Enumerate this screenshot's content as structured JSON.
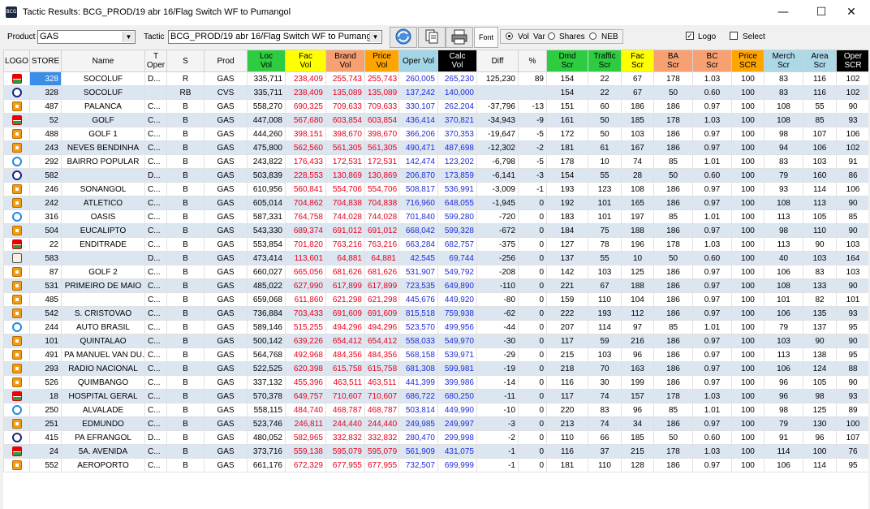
{
  "window": {
    "app_icon_text": "BCG",
    "title": "Tactic Results: BCG_PROD/19 abr 16/Flag Switch WF to Pumangol",
    "minimize": "—",
    "maximize": "☐",
    "close": "✕"
  },
  "toolbar": {
    "product_label": "Product",
    "product_value": "GAS",
    "tactic_label": "Tactic",
    "tactic_value": "BCG_PROD/19 abr 16/Flag Switch WF to Pumang",
    "font_label": "Font",
    "radio_vol": "Vol",
    "var_label": "Var",
    "radio_shares": "Shares",
    "radio_neb": "NEB",
    "logo_label": "Logo",
    "select_label": "Select",
    "logo_checked": true,
    "select_checked": false
  },
  "colors": {
    "green": "#2ecc40",
    "yellow": "#ffff00",
    "red_header": "#ff3333",
    "brand_header": "#f7a072",
    "price_header": "#ffa500",
    "oper_header": "#a3d5e6",
    "calc_header": "#000000",
    "blue_header": "#add8e6",
    "red_text": "#e8001c",
    "blue_text": "#1f2bd8"
  },
  "columns": [
    {
      "key": "logo",
      "label": "LOGO",
      "bg": "#f4f4f4",
      "fg": "#000"
    },
    {
      "key": "store",
      "label": "STORE",
      "bg": "#f4f4f4",
      "fg": "#000"
    },
    {
      "key": "name",
      "label": "Name",
      "bg": "#f4f4f4",
      "fg": "#000"
    },
    {
      "key": "toper",
      "label": "T\nOper",
      "bg": "#f4f4f4",
      "fg": "#000"
    },
    {
      "key": "s",
      "label": "S",
      "bg": "#f4f4f4",
      "fg": "#000"
    },
    {
      "key": "prod",
      "label": "Prod",
      "bg": "#f4f4f4",
      "fg": "#000"
    },
    {
      "key": "locvol",
      "label": "Loc\nVol",
      "bg": "#2ecc40",
      "fg": "#000"
    },
    {
      "key": "facvol",
      "label": "Fac\nVol",
      "bg": "#ffff00",
      "fg": "#000"
    },
    {
      "key": "brandvol",
      "label": "Brand\nVol",
      "bg": "#f7a072",
      "fg": "#000"
    },
    {
      "key": "pricevol",
      "label": "Price\nVol",
      "bg": "#ffa500",
      "fg": "#000"
    },
    {
      "key": "opervol",
      "label": "Oper Vol",
      "bg": "#a3d5e6",
      "fg": "#000"
    },
    {
      "key": "calcvol",
      "label": "Calc\nVol",
      "bg": "#000000",
      "fg": "#fff"
    },
    {
      "key": "diff",
      "label": "Diff",
      "bg": "#f4f4f4",
      "fg": "#000"
    },
    {
      "key": "pct",
      "label": "%",
      "bg": "#f4f4f4",
      "fg": "#000"
    },
    {
      "key": "dmdscr",
      "label": "Dmd\nScr",
      "bg": "#2ecc40",
      "fg": "#000"
    },
    {
      "key": "trafficscr",
      "label": "Traffic\nScr",
      "bg": "#2ecc40",
      "fg": "#000"
    },
    {
      "key": "facscr",
      "label": "Fac\nScr",
      "bg": "#ffff00",
      "fg": "#000"
    },
    {
      "key": "bascr",
      "label": "BA\nScr",
      "bg": "#f7a072",
      "fg": "#000"
    },
    {
      "key": "bcscr",
      "label": "BC\nScr",
      "bg": "#f7a072",
      "fg": "#000"
    },
    {
      "key": "pricescr",
      "label": "Price\nSCR",
      "bg": "#ffa500",
      "fg": "#000"
    },
    {
      "key": "merchscr",
      "label": "Merch\nScr",
      "bg": "#add8e6",
      "fg": "#000"
    },
    {
      "key": "areascr",
      "label": "Area\nScr",
      "bg": "#add8e6",
      "fg": "#000"
    },
    {
      "key": "operscr",
      "label": "Oper\nSCR",
      "bg": "#000000",
      "fg": "#fff"
    }
  ],
  "rows": [
    {
      "logo": "total-icon",
      "store": "328",
      "name": "SOCOLUF",
      "toper": "D...",
      "s": "R",
      "prod": "GAS",
      "locvol": "335,711",
      "facvol": "238,409",
      "brandvol": "255,743",
      "pricevol": "255,743",
      "opervol": "260,005",
      "calcvol": "265,230",
      "diff": "125,230",
      "pct": "89",
      "dmdscr": "154",
      "trafficscr": "22",
      "facscr": "67",
      "bascr": "178",
      "bcscr": "1.03",
      "pricescr": "100",
      "merchscr": "83",
      "areascr": "116",
      "operscr": "102"
    },
    {
      "logo": "sopor-icon",
      "store": "328",
      "name": "SOCOLUF",
      "toper": "",
      "s": "RB",
      "prod": "CVS",
      "locvol": "335,711",
      "facvol": "238,409",
      "brandvol": "135,089",
      "pricevol": "135,089",
      "opervol": "137,242",
      "calcvol": "140,000",
      "diff": "",
      "pct": "",
      "dmdscr": "154",
      "trafficscr": "22",
      "facscr": "67",
      "bascr": "50",
      "bcscr": "0.60",
      "pricescr": "100",
      "merchscr": "83",
      "areascr": "116",
      "operscr": "102"
    },
    {
      "logo": "sonangol-icon",
      "store": "487",
      "name": "PALANCA",
      "toper": "C...",
      "s": "B",
      "prod": "GAS",
      "locvol": "558,270",
      "facvol": "690,325",
      "brandvol": "709,633",
      "pricevol": "709,633",
      "opervol": "330,107",
      "calcvol": "262,204",
      "diff": "-37,796",
      "pct": "-13",
      "dmdscr": "151",
      "trafficscr": "60",
      "facscr": "186",
      "bascr": "186",
      "bcscr": "0.97",
      "pricescr": "100",
      "merchscr": "108",
      "areascr": "55",
      "operscr": "90"
    },
    {
      "logo": "total-icon",
      "store": "52",
      "name": "GOLF",
      "toper": "C...",
      "s": "B",
      "prod": "GAS",
      "locvol": "447,008",
      "facvol": "567,680",
      "brandvol": "603,854",
      "pricevol": "603,854",
      "opervol": "436,414",
      "calcvol": "370,821",
      "diff": "-34,943",
      "pct": "-9",
      "dmdscr": "161",
      "trafficscr": "50",
      "facscr": "185",
      "bascr": "178",
      "bcscr": "1.03",
      "pricescr": "100",
      "merchscr": "108",
      "areascr": "85",
      "operscr": "93"
    },
    {
      "logo": "sonangol-icon",
      "store": "488",
      "name": "GOLF 1",
      "toper": "C...",
      "s": "B",
      "prod": "GAS",
      "locvol": "444,260",
      "facvol": "398,151",
      "brandvol": "398,670",
      "pricevol": "398,670",
      "opervol": "366,206",
      "calcvol": "370,353",
      "diff": "-19,647",
      "pct": "-5",
      "dmdscr": "172",
      "trafficscr": "50",
      "facscr": "103",
      "bascr": "186",
      "bcscr": "0.97",
      "pricescr": "100",
      "merchscr": "98",
      "areascr": "107",
      "operscr": "106"
    },
    {
      "logo": "sonangol-icon",
      "store": "243",
      "name": "NEVES BENDINHA",
      "toper": "C...",
      "s": "B",
      "prod": "GAS",
      "locvol": "475,800",
      "facvol": "562,560",
      "brandvol": "561,305",
      "pricevol": "561,305",
      "opervol": "490,471",
      "calcvol": "487,698",
      "diff": "-12,302",
      "pct": "-2",
      "dmdscr": "181",
      "trafficscr": "61",
      "facscr": "167",
      "bascr": "186",
      "bcscr": "0.97",
      "pricescr": "100",
      "merchscr": "94",
      "areascr": "106",
      "operscr": "102"
    },
    {
      "logo": "galp-icon",
      "store": "292",
      "name": "BAIRRO POPULAR",
      "toper": "C...",
      "s": "B",
      "prod": "GAS",
      "locvol": "243,822",
      "facvol": "176,433",
      "brandvol": "172,531",
      "pricevol": "172,531",
      "opervol": "142,474",
      "calcvol": "123,202",
      "diff": "-6,798",
      "pct": "-5",
      "dmdscr": "178",
      "trafficscr": "10",
      "facscr": "74",
      "bascr": "85",
      "bcscr": "1.01",
      "pricescr": "100",
      "merchscr": "83",
      "areascr": "103",
      "operscr": "91"
    },
    {
      "logo": "sopor-icon",
      "store": "582",
      "name": "",
      "toper": "D...",
      "s": "B",
      "prod": "GAS",
      "locvol": "503,839",
      "facvol": "228,553",
      "brandvol": "130,869",
      "pricevol": "130,869",
      "opervol": "206,870",
      "calcvol": "173,859",
      "diff": "-6,141",
      "pct": "-3",
      "dmdscr": "154",
      "trafficscr": "55",
      "facscr": "28",
      "bascr": "50",
      "bcscr": "0.60",
      "pricescr": "100",
      "merchscr": "79",
      "areascr": "160",
      "operscr": "86"
    },
    {
      "logo": "sonangol-icon",
      "store": "246",
      "name": "SONANGOL",
      "toper": "C...",
      "s": "B",
      "prod": "GAS",
      "locvol": "610,956",
      "facvol": "560,841",
      "brandvol": "554,706",
      "pricevol": "554,706",
      "opervol": "508,817",
      "calcvol": "536,991",
      "diff": "-3,009",
      "pct": "-1",
      "dmdscr": "193",
      "trafficscr": "123",
      "facscr": "108",
      "bascr": "186",
      "bcscr": "0.97",
      "pricescr": "100",
      "merchscr": "93",
      "areascr": "114",
      "operscr": "106"
    },
    {
      "logo": "sonangol-icon",
      "store": "242",
      "name": "ATLETICO",
      "toper": "C...",
      "s": "B",
      "prod": "GAS",
      "locvol": "605,014",
      "facvol": "704,862",
      "brandvol": "704,838",
      "pricevol": "704,838",
      "opervol": "716,960",
      "calcvol": "648,055",
      "diff": "-1,945",
      "pct": "0",
      "dmdscr": "192",
      "trafficscr": "101",
      "facscr": "165",
      "bascr": "186",
      "bcscr": "0.97",
      "pricescr": "100",
      "merchscr": "108",
      "areascr": "113",
      "operscr": "90"
    },
    {
      "logo": "galp-icon",
      "store": "316",
      "name": "OASIS",
      "toper": "C...",
      "s": "B",
      "prod": "GAS",
      "locvol": "587,331",
      "facvol": "764,758",
      "brandvol": "744,028",
      "pricevol": "744,028",
      "opervol": "701,840",
      "calcvol": "599,280",
      "diff": "-720",
      "pct": "0",
      "dmdscr": "183",
      "trafficscr": "101",
      "facscr": "197",
      "bascr": "85",
      "bcscr": "1.01",
      "pricescr": "100",
      "merchscr": "113",
      "areascr": "105",
      "operscr": "85"
    },
    {
      "logo": "sonangol-icon",
      "store": "504",
      "name": "EUCALIPTO",
      "toper": "C...",
      "s": "B",
      "prod": "GAS",
      "locvol": "543,330",
      "facvol": "689,374",
      "brandvol": "691,012",
      "pricevol": "691,012",
      "opervol": "668,042",
      "calcvol": "599,328",
      "diff": "-672",
      "pct": "0",
      "dmdscr": "184",
      "trafficscr": "75",
      "facscr": "188",
      "bascr": "186",
      "bcscr": "0.97",
      "pricescr": "100",
      "merchscr": "98",
      "areascr": "110",
      "operscr": "90"
    },
    {
      "logo": "total-icon",
      "store": "22",
      "name": "ENDITRADE",
      "toper": "C...",
      "s": "B",
      "prod": "GAS",
      "locvol": "553,854",
      "facvol": "701,820",
      "brandvol": "763,216",
      "pricevol": "763,216",
      "opervol": "663,284",
      "calcvol": "682,757",
      "diff": "-375",
      "pct": "0",
      "dmdscr": "127",
      "trafficscr": "78",
      "facscr": "196",
      "bascr": "178",
      "bcscr": "1.03",
      "pricescr": "100",
      "merchscr": "113",
      "areascr": "90",
      "operscr": "103"
    },
    {
      "logo": "pump-icon",
      "store": "583",
      "name": "",
      "toper": "D...",
      "s": "B",
      "prod": "GAS",
      "locvol": "473,414",
      "facvol": "113,601",
      "brandvol": "64,881",
      "pricevol": "64,881",
      "opervol": "42,545",
      "calcvol": "69,744",
      "diff": "-256",
      "pct": "0",
      "dmdscr": "137",
      "trafficscr": "55",
      "facscr": "10",
      "bascr": "50",
      "bcscr": "0.60",
      "pricescr": "100",
      "merchscr": "40",
      "areascr": "103",
      "operscr": "164"
    },
    {
      "logo": "sonangol-icon",
      "store": "87",
      "name": "GOLF 2",
      "toper": "C...",
      "s": "B",
      "prod": "GAS",
      "locvol": "660,027",
      "facvol": "665,056",
      "brandvol": "681,626",
      "pricevol": "681,626",
      "opervol": "531,907",
      "calcvol": "549,792",
      "diff": "-208",
      "pct": "0",
      "dmdscr": "142",
      "trafficscr": "103",
      "facscr": "125",
      "bascr": "186",
      "bcscr": "0.97",
      "pricescr": "100",
      "merchscr": "106",
      "areascr": "83",
      "operscr": "103"
    },
    {
      "logo": "sonangol-icon",
      "store": "531",
      "name": "PRIMEIRO DE MAIO",
      "toper": "C...",
      "s": "B",
      "prod": "GAS",
      "locvol": "485,022",
      "facvol": "627,990",
      "brandvol": "617,899",
      "pricevol": "617,899",
      "opervol": "723,535",
      "calcvol": "649,890",
      "diff": "-110",
      "pct": "0",
      "dmdscr": "221",
      "trafficscr": "67",
      "facscr": "188",
      "bascr": "186",
      "bcscr": "0.97",
      "pricescr": "100",
      "merchscr": "108",
      "areascr": "133",
      "operscr": "90"
    },
    {
      "logo": "sonangol-icon",
      "store": "485",
      "name": "",
      "toper": "C...",
      "s": "B",
      "prod": "GAS",
      "locvol": "659,068",
      "facvol": "611,860",
      "brandvol": "621,298",
      "pricevol": "621,298",
      "opervol": "445,676",
      "calcvol": "449,920",
      "diff": "-80",
      "pct": "0",
      "dmdscr": "159",
      "trafficscr": "110",
      "facscr": "104",
      "bascr": "186",
      "bcscr": "0.97",
      "pricescr": "100",
      "merchscr": "101",
      "areascr": "82",
      "operscr": "101"
    },
    {
      "logo": "sonangol-icon",
      "store": "542",
      "name": "S. CRISTOVAO",
      "toper": "C...",
      "s": "B",
      "prod": "GAS",
      "locvol": "736,884",
      "facvol": "703,433",
      "brandvol": "691,609",
      "pricevol": "691,609",
      "opervol": "815,518",
      "calcvol": "759,938",
      "diff": "-62",
      "pct": "0",
      "dmdscr": "222",
      "trafficscr": "193",
      "facscr": "112",
      "bascr": "186",
      "bcscr": "0.97",
      "pricescr": "100",
      "merchscr": "106",
      "areascr": "135",
      "operscr": "93"
    },
    {
      "logo": "galp-icon",
      "store": "244",
      "name": "AUTO BRASIL",
      "toper": "C...",
      "s": "B",
      "prod": "GAS",
      "locvol": "589,146",
      "facvol": "515,255",
      "brandvol": "494,296",
      "pricevol": "494,296",
      "opervol": "523,570",
      "calcvol": "499,956",
      "diff": "-44",
      "pct": "0",
      "dmdscr": "207",
      "trafficscr": "114",
      "facscr": "97",
      "bascr": "85",
      "bcscr": "1.01",
      "pricescr": "100",
      "merchscr": "79",
      "areascr": "137",
      "operscr": "95"
    },
    {
      "logo": "sonangol-icon",
      "store": "101",
      "name": "QUINTALAO",
      "toper": "C...",
      "s": "B",
      "prod": "GAS",
      "locvol": "500,142",
      "facvol": "639,226",
      "brandvol": "654,412",
      "pricevol": "654,412",
      "opervol": "558,033",
      "calcvol": "549,970",
      "diff": "-30",
      "pct": "0",
      "dmdscr": "117",
      "trafficscr": "59",
      "facscr": "216",
      "bascr": "186",
      "bcscr": "0.97",
      "pricescr": "100",
      "merchscr": "103",
      "areascr": "90",
      "operscr": "90"
    },
    {
      "logo": "sonangol-icon",
      "store": "491",
      "name": "PA MANUEL VAN DU...",
      "toper": "C...",
      "s": "B",
      "prod": "GAS",
      "locvol": "564,768",
      "facvol": "492,968",
      "brandvol": "484,356",
      "pricevol": "484,356",
      "opervol": "568,158",
      "calcvol": "539,971",
      "diff": "-29",
      "pct": "0",
      "dmdscr": "215",
      "trafficscr": "103",
      "facscr": "96",
      "bascr": "186",
      "bcscr": "0.97",
      "pricescr": "100",
      "merchscr": "113",
      "areascr": "138",
      "operscr": "95"
    },
    {
      "logo": "sonangol-icon",
      "store": "293",
      "name": "RADIO NACIONAL",
      "toper": "C...",
      "s": "B",
      "prod": "GAS",
      "locvol": "522,525",
      "facvol": "620,398",
      "brandvol": "615,758",
      "pricevol": "615,758",
      "opervol": "681,308",
      "calcvol": "599,981",
      "diff": "-19",
      "pct": "0",
      "dmdscr": "218",
      "trafficscr": "70",
      "facscr": "163",
      "bascr": "186",
      "bcscr": "0.97",
      "pricescr": "100",
      "merchscr": "106",
      "areascr": "124",
      "operscr": "88"
    },
    {
      "logo": "sonangol-icon",
      "store": "526",
      "name": "QUIMBANGO",
      "toper": "C...",
      "s": "B",
      "prod": "GAS",
      "locvol": "337,132",
      "facvol": "455,396",
      "brandvol": "463,511",
      "pricevol": "463,511",
      "opervol": "441,399",
      "calcvol": "399,986",
      "diff": "-14",
      "pct": "0",
      "dmdscr": "116",
      "trafficscr": "30",
      "facscr": "199",
      "bascr": "186",
      "bcscr": "0.97",
      "pricescr": "100",
      "merchscr": "96",
      "areascr": "105",
      "operscr": "90"
    },
    {
      "logo": "total-icon",
      "store": "18",
      "name": "HOSPITAL GERAL",
      "toper": "C...",
      "s": "B",
      "prod": "GAS",
      "locvol": "570,378",
      "facvol": "649,757",
      "brandvol": "710,607",
      "pricevol": "710,607",
      "opervol": "686,722",
      "calcvol": "680,250",
      "diff": "-11",
      "pct": "0",
      "dmdscr": "117",
      "trafficscr": "74",
      "facscr": "157",
      "bascr": "178",
      "bcscr": "1.03",
      "pricescr": "100",
      "merchscr": "96",
      "areascr": "98",
      "operscr": "93"
    },
    {
      "logo": "galp-icon",
      "store": "250",
      "name": "ALVALADE",
      "toper": "C...",
      "s": "B",
      "prod": "GAS",
      "locvol": "558,115",
      "facvol": "484,740",
      "brandvol": "468,787",
      "pricevol": "468,787",
      "opervol": "503,814",
      "calcvol": "449,990",
      "diff": "-10",
      "pct": "0",
      "dmdscr": "220",
      "trafficscr": "83",
      "facscr": "96",
      "bascr": "85",
      "bcscr": "1.01",
      "pricescr": "100",
      "merchscr": "98",
      "areascr": "125",
      "operscr": "89"
    },
    {
      "logo": "sonangol-icon",
      "store": "251",
      "name": "EDMUNDO",
      "toper": "C...",
      "s": "B",
      "prod": "GAS",
      "locvol": "523,746",
      "facvol": "246,811",
      "brandvol": "244,440",
      "pricevol": "244,440",
      "opervol": "249,985",
      "calcvol": "249,997",
      "diff": "-3",
      "pct": "0",
      "dmdscr": "213",
      "trafficscr": "74",
      "facscr": "34",
      "bascr": "186",
      "bcscr": "0.97",
      "pricescr": "100",
      "merchscr": "79",
      "areascr": "130",
      "operscr": "100"
    },
    {
      "logo": "sopor-icon",
      "store": "415",
      "name": "PA EFRANGOL",
      "toper": "D...",
      "s": "B",
      "prod": "GAS",
      "locvol": "480,052",
      "facvol": "582,965",
      "brandvol": "332,832",
      "pricevol": "332,832",
      "opervol": "280,470",
      "calcvol": "299,998",
      "diff": "-2",
      "pct": "0",
      "dmdscr": "110",
      "trafficscr": "66",
      "facscr": "185",
      "bascr": "50",
      "bcscr": "0.60",
      "pricescr": "100",
      "merchscr": "91",
      "areascr": "96",
      "operscr": "107"
    },
    {
      "logo": "total-icon",
      "store": "24",
      "name": "5A. AVENIDA",
      "toper": "C...",
      "s": "B",
      "prod": "GAS",
      "locvol": "373,716",
      "facvol": "559,138",
      "brandvol": "595,079",
      "pricevol": "595,079",
      "opervol": "561,909",
      "calcvol": "431,075",
      "diff": "-1",
      "pct": "0",
      "dmdscr": "116",
      "trafficscr": "37",
      "facscr": "215",
      "bascr": "178",
      "bcscr": "1.03",
      "pricescr": "100",
      "merchscr": "114",
      "areascr": "100",
      "operscr": "76"
    },
    {
      "logo": "sonangol-icon",
      "store": "552",
      "name": "AEROPORTO",
      "toper": "C...",
      "s": "B",
      "prod": "GAS",
      "locvol": "661,176",
      "facvol": "672,329",
      "brandvol": "677,955",
      "pricevol": "677,955",
      "opervol": "732,507",
      "calcvol": "699,999",
      "diff": "-1",
      "pct": "0",
      "dmdscr": "181",
      "trafficscr": "110",
      "facscr": "128",
      "bascr": "186",
      "bcscr": "0.97",
      "pricescr": "100",
      "merchscr": "106",
      "areascr": "114",
      "operscr": "95"
    }
  ]
}
